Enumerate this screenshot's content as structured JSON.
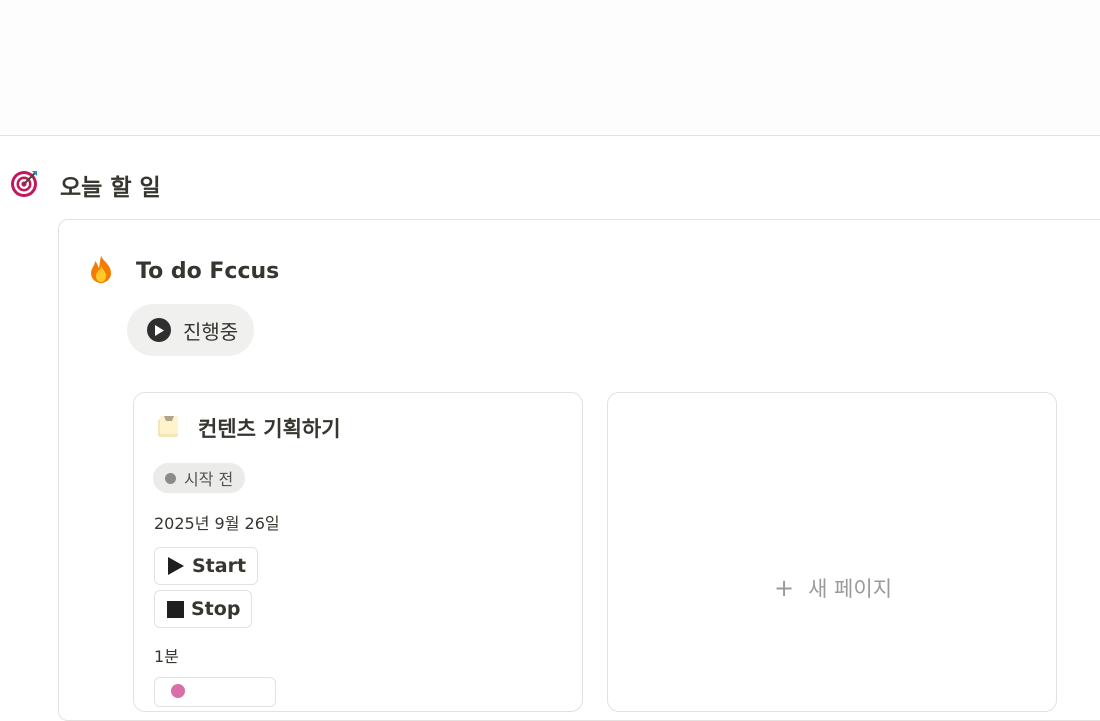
{
  "section": {
    "title": "오늘 할 일",
    "icon": "target-icon"
  },
  "group": {
    "title": "To do Fccus",
    "icon": "fire-icon"
  },
  "status_filter": {
    "label": "진행중",
    "icon": "play-circle-icon"
  },
  "cards": [
    {
      "title": "컨텐츠 기획하기",
      "icon": "memo-icon",
      "status": "시작 전",
      "date": "2025년 9월 26일",
      "start_label": "Start",
      "stop_label": "Stop",
      "duration": "1분"
    }
  ],
  "new_page": {
    "plus": "+",
    "label": "새 페이지"
  },
  "colors": {
    "border": "#e3e2e0",
    "text": "#37352f",
    "muted": "#9b9a97",
    "pill_bg": "#f0f0ef",
    "tag_bg": "#ebebea"
  }
}
